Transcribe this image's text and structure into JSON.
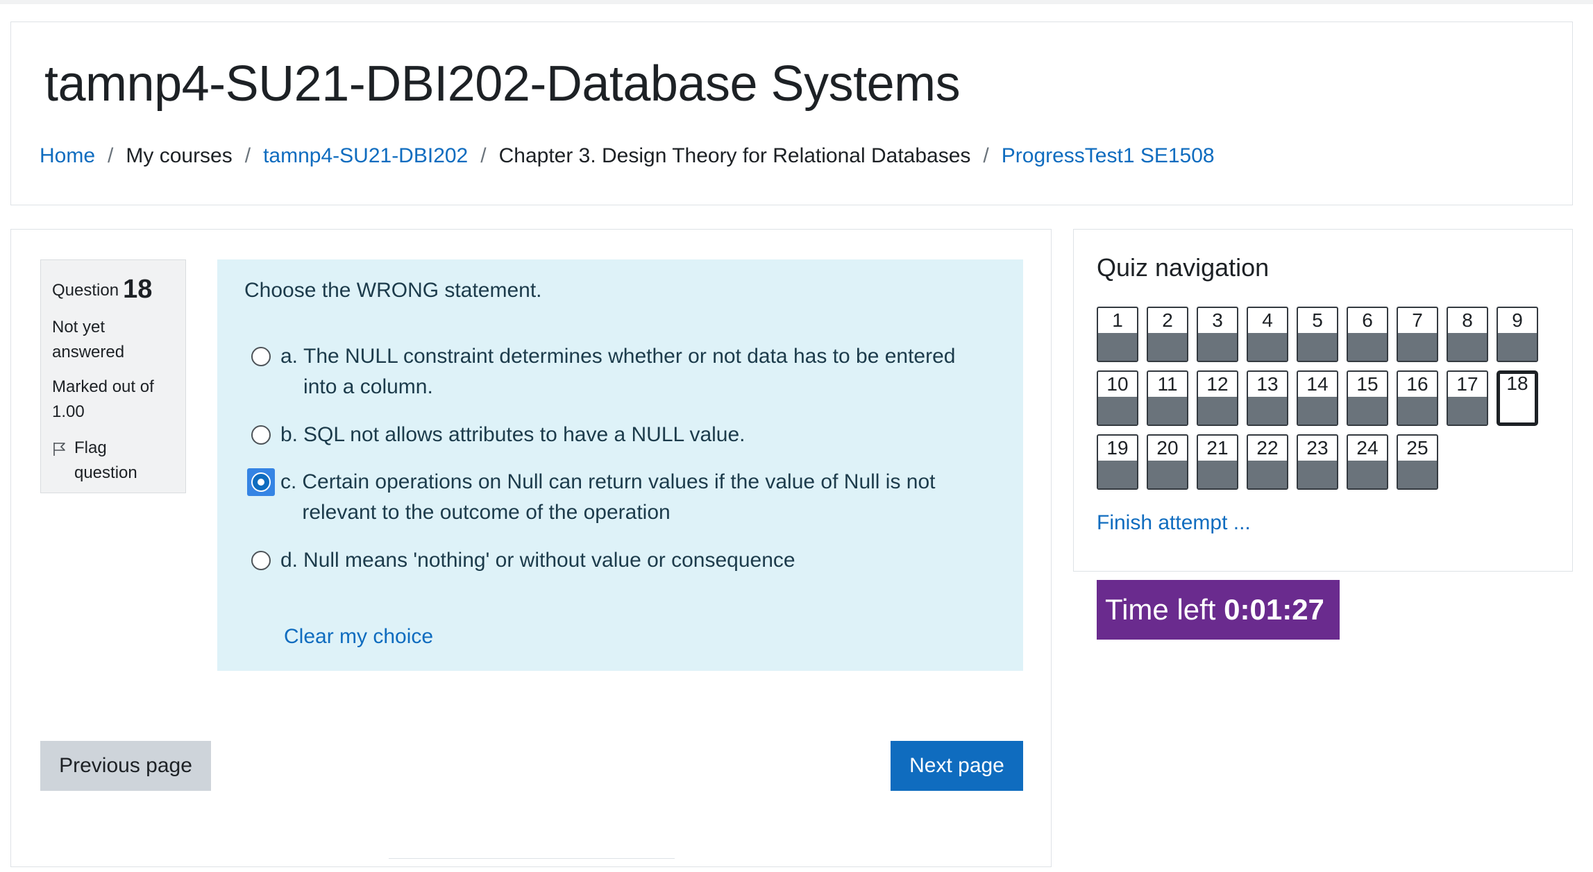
{
  "course_title": "tamnp4-SU21-DBI202-Database Systems",
  "breadcrumb": [
    {
      "label": "Home",
      "link": true
    },
    {
      "label": "My courses",
      "link": false
    },
    {
      "label": "tamnp4-SU21-DBI202",
      "link": true
    },
    {
      "label": "Chapter 3. Design Theory for Relational Databases",
      "link": false
    },
    {
      "label": "ProgressTest1 SE1508",
      "link": true
    }
  ],
  "question_info": {
    "label": "Question",
    "number": "18",
    "state": "Not yet answered",
    "grade_line1": "Marked out of",
    "grade_line2": "1.00",
    "flag_label": "Flag question"
  },
  "question": {
    "text": "Choose the WRONG statement.",
    "options": [
      {
        "letter": "a.",
        "text": "The NULL constraint determines whether or not data has to be entered into a column.",
        "checked": false
      },
      {
        "letter": "b.",
        "text": "SQL not allows attributes to have a NULL value.",
        "checked": false
      },
      {
        "letter": "c.",
        "text": "Certain operations on Null can return values if the value of Null is not relevant to the outcome of the operation",
        "checked": true
      },
      {
        "letter": "d.",
        "text": "Null means 'nothing' or without value or consequence",
        "checked": false
      }
    ],
    "clear_label": "Clear my choice"
  },
  "buttons": {
    "previous": "Previous page",
    "next": "Next page"
  },
  "quiz_nav": {
    "title": "Quiz navigation",
    "questions": [
      "1",
      "2",
      "3",
      "4",
      "5",
      "6",
      "7",
      "8",
      "9",
      "10",
      "11",
      "12",
      "13",
      "14",
      "15",
      "16",
      "17",
      "18",
      "19",
      "20",
      "21",
      "22",
      "23",
      "24",
      "25"
    ],
    "current": "18",
    "finish_label": "Finish attempt ..."
  },
  "timer": {
    "label": "Time left",
    "value": "0:01:27"
  },
  "colors": {
    "link": "#0f6cbf",
    "formulation_bg": "#def2f8",
    "timer_bg": "#6a2b8e",
    "nav_bar": "#6a737b"
  }
}
